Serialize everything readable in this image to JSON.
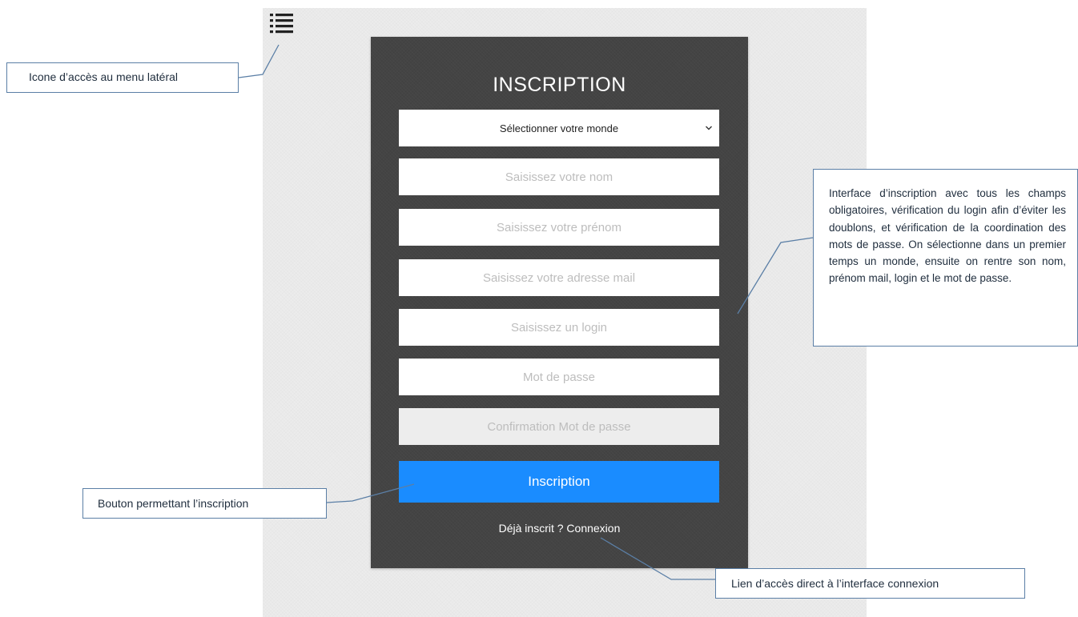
{
  "form": {
    "title": "INSCRIPTION",
    "world_select": "Sélectionner votre monde",
    "nom_placeholder": "Saisissez votre nom",
    "prenom_placeholder": "Saisissez votre prénom",
    "mail_placeholder": "Saisissez votre adresse mail",
    "login_placeholder": "Saisissez un login",
    "password_placeholder": "Mot de passe",
    "confirm_placeholder": "Confirmation Mot de passe",
    "submit_label": "Inscription",
    "login_link": "Déjà inscrit ? Connexion"
  },
  "annotations": {
    "menu": "Icone d’accès au menu latéral",
    "button": "Bouton permettant l’inscription",
    "link": "Lien d’accès direct à l’interface connexion",
    "interface": "Interface d’inscription avec tous les champs obligatoires, vérification du login afin d’éviter les doublons, et vérification de la coordination des mots de passe. On sélectionne dans un premier temps un monde, ensuite on rentre son nom, prénom mail, login et le mot de passe."
  },
  "icons": {
    "menu": "list-menu-icon",
    "select": "chevron-down-icon"
  },
  "colors": {
    "card": "#444444",
    "button": "#1a8cff",
    "callout_border": "#5b7fa6",
    "page": "#ececec"
  }
}
